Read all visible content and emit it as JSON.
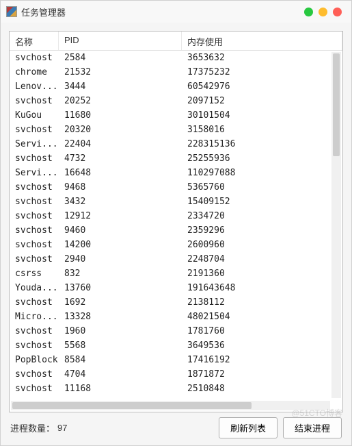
{
  "window": {
    "title": "任务管理器"
  },
  "columns": {
    "name": "名称",
    "pid": "PID",
    "memory": "内存使用"
  },
  "processes": [
    {
      "name": "svchost",
      "pid": "2584",
      "memory": "3653632"
    },
    {
      "name": "chrome",
      "pid": "21532",
      "memory": "17375232"
    },
    {
      "name": "Lenov...",
      "pid": "3444",
      "memory": "60542976"
    },
    {
      "name": "svchost",
      "pid": "20252",
      "memory": "2097152"
    },
    {
      "name": "KuGou",
      "pid": "11680",
      "memory": "30101504"
    },
    {
      "name": "svchost",
      "pid": "20320",
      "memory": "3158016"
    },
    {
      "name": "Servi...",
      "pid": "22404",
      "memory": "228315136"
    },
    {
      "name": "svchost",
      "pid": "4732",
      "memory": "25255936"
    },
    {
      "name": "Servi...",
      "pid": "16648",
      "memory": "110297088"
    },
    {
      "name": "svchost",
      "pid": "9468",
      "memory": "5365760"
    },
    {
      "name": "svchost",
      "pid": "3432",
      "memory": "15409152"
    },
    {
      "name": "svchost",
      "pid": "12912",
      "memory": "2334720"
    },
    {
      "name": "svchost",
      "pid": "9460",
      "memory": "2359296"
    },
    {
      "name": "svchost",
      "pid": "14200",
      "memory": "2600960"
    },
    {
      "name": "svchost",
      "pid": "2940",
      "memory": "2248704"
    },
    {
      "name": "csrss",
      "pid": "832",
      "memory": "2191360"
    },
    {
      "name": "Youda...",
      "pid": "13760",
      "memory": "191643648"
    },
    {
      "name": "svchost",
      "pid": "1692",
      "memory": "2138112"
    },
    {
      "name": "Micro...",
      "pid": "13328",
      "memory": "48021504"
    },
    {
      "name": "svchost",
      "pid": "1960",
      "memory": "1781760"
    },
    {
      "name": "svchost",
      "pid": "5568",
      "memory": "3649536"
    },
    {
      "name": "PopBlock",
      "pid": "8584",
      "memory": "17416192"
    },
    {
      "name": "svchost",
      "pid": "4704",
      "memory": "1871872"
    },
    {
      "name": "svchost",
      "pid": "11168",
      "memory": "2510848"
    }
  ],
  "footer": {
    "label": "进程数量：",
    "count": "97"
  },
  "buttons": {
    "refresh": "刷新列表",
    "end": "结束进程"
  },
  "watermark": "@51CTO博客"
}
